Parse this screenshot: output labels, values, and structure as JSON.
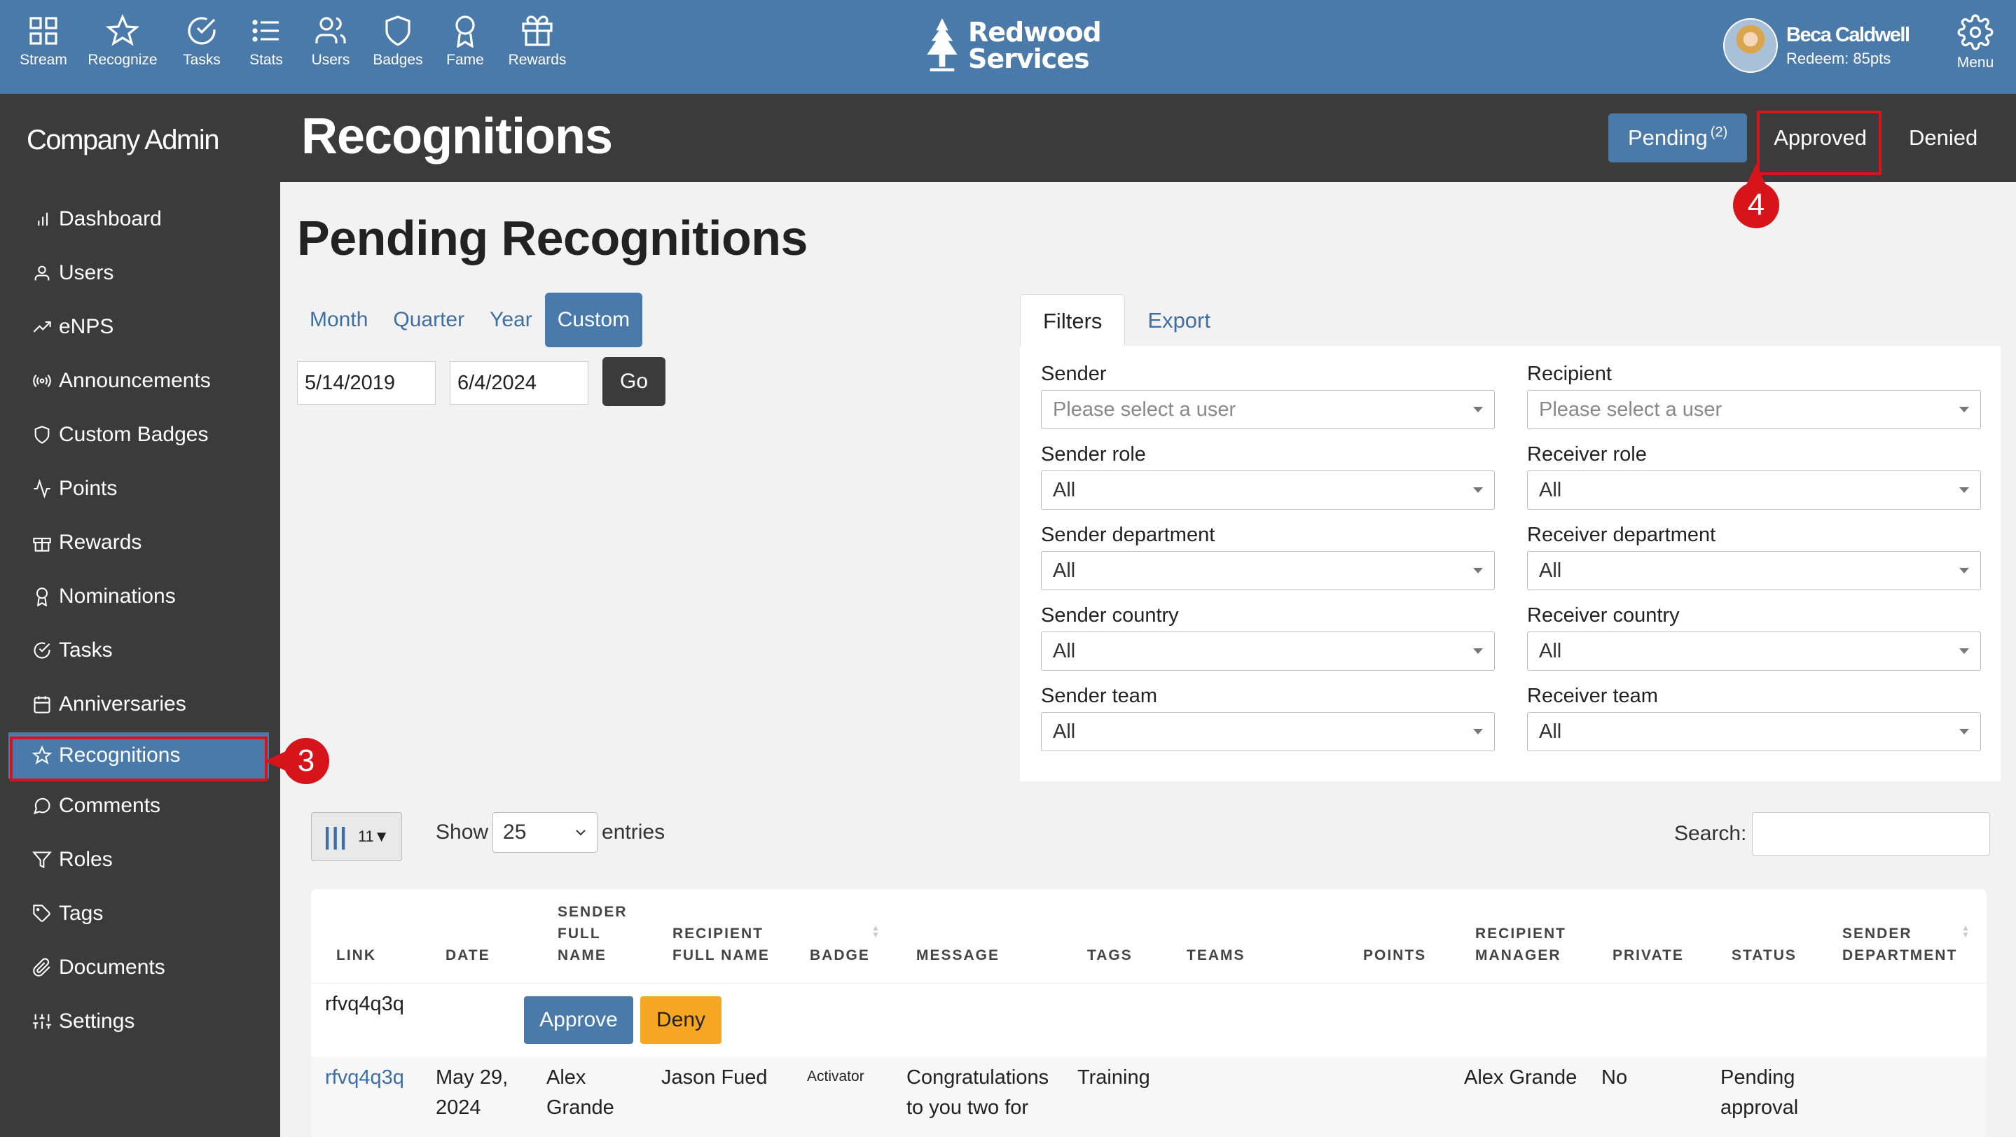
{
  "topnav": {
    "items": [
      {
        "label": "Stream",
        "icon": "grid-icon"
      },
      {
        "label": "Recognize",
        "icon": "star-icon"
      },
      {
        "label": "Tasks",
        "icon": "check-circle-icon"
      },
      {
        "label": "Stats",
        "icon": "list-icon"
      },
      {
        "label": "Users",
        "icon": "users-icon"
      },
      {
        "label": "Badges",
        "icon": "shield-icon"
      },
      {
        "label": "Fame",
        "icon": "award-icon"
      },
      {
        "label": "Rewards",
        "icon": "gift-icon"
      }
    ],
    "brand": "Redwood Services",
    "user_name": "Beca Caldwell",
    "redeem": "Redeem: 85pts",
    "menu_label": "Menu"
  },
  "sidebar": {
    "title": "Company Admin",
    "items": [
      {
        "label": "Dashboard",
        "icon": "bar-chart-icon"
      },
      {
        "label": "Users",
        "icon": "user-icon"
      },
      {
        "label": "eNPS",
        "icon": "trend-up-icon"
      },
      {
        "label": "Announcements",
        "icon": "broadcast-icon"
      },
      {
        "label": "Custom Badges",
        "icon": "shield-icon"
      },
      {
        "label": "Points",
        "icon": "activity-icon"
      },
      {
        "label": "Rewards",
        "icon": "gift-icon"
      },
      {
        "label": "Nominations",
        "icon": "award-icon"
      },
      {
        "label": "Tasks",
        "icon": "check-circle-icon"
      },
      {
        "label": "Anniversaries",
        "icon": "calendar-icon"
      },
      {
        "label": "Recognitions",
        "icon": "star-icon"
      },
      {
        "label": "Comments",
        "icon": "message-circle-icon"
      },
      {
        "label": "Roles",
        "icon": "filter-icon"
      },
      {
        "label": "Tags",
        "icon": "tag-icon"
      },
      {
        "label": "Documents",
        "icon": "paperclip-icon"
      },
      {
        "label": "Settings",
        "icon": "sliders-icon"
      }
    ],
    "step_number": "3"
  },
  "header": {
    "title": "Recognitions",
    "tabs": {
      "pending": "Pending",
      "pending_count": "(2)",
      "approved": "Approved",
      "denied": "Denied"
    },
    "step_number": "4"
  },
  "main": {
    "title": "Pending Recognitions",
    "periods": [
      "Month",
      "Quarter",
      "Year",
      "Custom"
    ],
    "active_period": "Custom",
    "date_from": "5/14/2019",
    "date_to": "6/4/2024",
    "go_label": "Go"
  },
  "filters": {
    "tab_filters": "Filters",
    "tab_export": "Export",
    "sender": {
      "label": "Sender",
      "value": "Please select a user"
    },
    "recipient": {
      "label": "Recipient",
      "value": "Please select a user"
    },
    "sender_role": {
      "label": "Sender role",
      "value": "All"
    },
    "receiver_role": {
      "label": "Receiver role",
      "value": "All"
    },
    "sender_department": {
      "label": "Sender department",
      "value": "All"
    },
    "receiver_department": {
      "label": "Receiver department",
      "value": "All"
    },
    "sender_country": {
      "label": "Sender country",
      "value": "All"
    },
    "receiver_country": {
      "label": "Receiver country",
      "value": "All"
    },
    "sender_team": {
      "label": "Sender team",
      "value": "All"
    },
    "receiver_team": {
      "label": "Receiver team",
      "value": "All"
    }
  },
  "table_controls": {
    "column_count": "11▼",
    "show_label": "Show",
    "entries_value": "25",
    "entries_label": "entries",
    "search_label": "Search:"
  },
  "table": {
    "headers": {
      "link": "LINK",
      "date": "DATE",
      "sender": "SENDER FULL NAME",
      "recipient": "RECIPIENT FULL NAME",
      "badge": "BADGE",
      "message": "MESSAGE",
      "tags": "TAGS",
      "teams": "TEAMS",
      "points": "POINTS",
      "recipient_manager": "RECIPIENT MANAGER",
      "private": "PRIVATE",
      "status": "STATUS",
      "sender_department": "SENDER DEPARTMENT"
    },
    "action_row": {
      "link": "rfvq4q3q",
      "approve": "Approve",
      "deny": "Deny"
    },
    "data_row": {
      "link": "rfvq4q3q",
      "date": "May 29, 2024",
      "sender": "Alex Grande",
      "recipient": "Jason Fued",
      "badge": "Activator",
      "message": "Congratulations to you two for",
      "tags": "Training",
      "recipient_manager": "Alex Grande",
      "private": "No",
      "status": "Pending approval"
    }
  },
  "colors": {
    "primary": "#4a7aaa",
    "dark": "#3b3b3b",
    "highlight": "#d7141a",
    "deny": "#f5a623"
  }
}
